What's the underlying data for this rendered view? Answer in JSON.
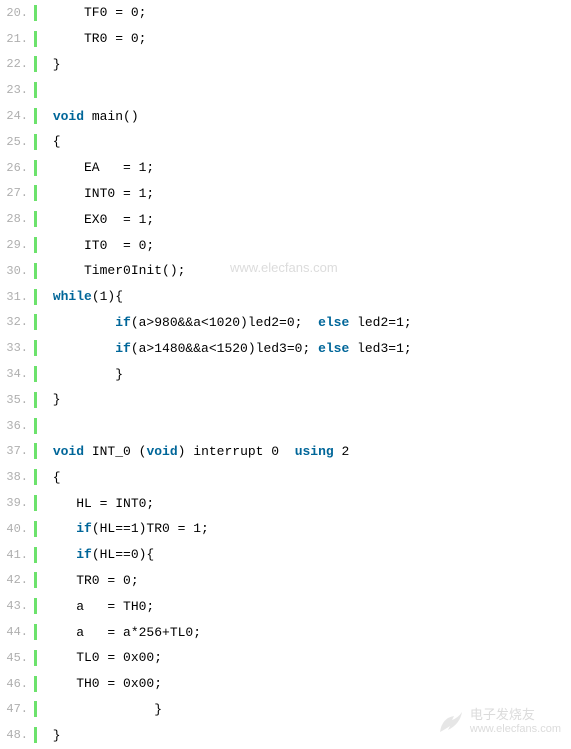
{
  "watermark": "www.elecfans.com",
  "footer": {
    "cn": "电子发烧友",
    "url": "www.elecfans.com"
  },
  "lines": [
    {
      "num": "20.",
      "tokens": [
        {
          "t": "     TF0 = 0;",
          "c": ""
        }
      ]
    },
    {
      "num": "21.",
      "tokens": [
        {
          "t": "     TR0 = 0;",
          "c": ""
        }
      ]
    },
    {
      "num": "22.",
      "tokens": [
        {
          "t": " }",
          "c": ""
        }
      ]
    },
    {
      "num": "23.",
      "tokens": [
        {
          "t": "",
          "c": ""
        }
      ]
    },
    {
      "num": "24.",
      "tokens": [
        {
          "t": " ",
          "c": ""
        },
        {
          "t": "void",
          "c": "keyword"
        },
        {
          "t": " main()",
          "c": ""
        }
      ]
    },
    {
      "num": "25.",
      "tokens": [
        {
          "t": " {",
          "c": ""
        }
      ]
    },
    {
      "num": "26.",
      "tokens": [
        {
          "t": "     EA   = 1;",
          "c": ""
        }
      ]
    },
    {
      "num": "27.",
      "tokens": [
        {
          "t": "     INT0 = 1;",
          "c": ""
        }
      ]
    },
    {
      "num": "28.",
      "tokens": [
        {
          "t": "     EX0  = 1;",
          "c": ""
        }
      ]
    },
    {
      "num": "29.",
      "tokens": [
        {
          "t": "     IT0  = 0;",
          "c": ""
        }
      ]
    },
    {
      "num": "30.",
      "tokens": [
        {
          "t": "     Timer0Init();",
          "c": ""
        }
      ]
    },
    {
      "num": "31.",
      "tokens": [
        {
          "t": " ",
          "c": ""
        },
        {
          "t": "while",
          "c": "keyword"
        },
        {
          "t": "(1){",
          "c": ""
        }
      ]
    },
    {
      "num": "32.",
      "tokens": [
        {
          "t": "         ",
          "c": ""
        },
        {
          "t": "if",
          "c": "keyword"
        },
        {
          "t": "(a>980&&a<1020)led2=0;  ",
          "c": ""
        },
        {
          "t": "else",
          "c": "keyword"
        },
        {
          "t": " led2=1;",
          "c": ""
        }
      ]
    },
    {
      "num": "33.",
      "tokens": [
        {
          "t": "         ",
          "c": ""
        },
        {
          "t": "if",
          "c": "keyword"
        },
        {
          "t": "(a>1480&&a<1520)led3=0; ",
          "c": ""
        },
        {
          "t": "else",
          "c": "keyword"
        },
        {
          "t": " led3=1;",
          "c": ""
        }
      ]
    },
    {
      "num": "34.",
      "tokens": [
        {
          "t": "         }",
          "c": ""
        }
      ]
    },
    {
      "num": "35.",
      "tokens": [
        {
          "t": " }",
          "c": ""
        }
      ]
    },
    {
      "num": "36.",
      "tokens": [
        {
          "t": "",
          "c": ""
        }
      ]
    },
    {
      "num": "37.",
      "tokens": [
        {
          "t": " ",
          "c": ""
        },
        {
          "t": "void",
          "c": "keyword"
        },
        {
          "t": " INT_0 (",
          "c": ""
        },
        {
          "t": "void",
          "c": "keyword"
        },
        {
          "t": ") interrupt 0  ",
          "c": ""
        },
        {
          "t": "using",
          "c": "keyword"
        },
        {
          "t": " 2",
          "c": ""
        }
      ]
    },
    {
      "num": "38.",
      "tokens": [
        {
          "t": " {",
          "c": ""
        }
      ]
    },
    {
      "num": "39.",
      "tokens": [
        {
          "t": "    HL = INT0;",
          "c": ""
        }
      ]
    },
    {
      "num": "40.",
      "tokens": [
        {
          "t": "    ",
          "c": ""
        },
        {
          "t": "if",
          "c": "keyword"
        },
        {
          "t": "(HL==1)TR0 = 1;",
          "c": ""
        }
      ]
    },
    {
      "num": "41.",
      "tokens": [
        {
          "t": "    ",
          "c": ""
        },
        {
          "t": "if",
          "c": "keyword"
        },
        {
          "t": "(HL==0){",
          "c": ""
        }
      ]
    },
    {
      "num": "42.",
      "tokens": [
        {
          "t": "    TR0 = 0;",
          "c": ""
        }
      ]
    },
    {
      "num": "43.",
      "tokens": [
        {
          "t": "    a   = TH0;",
          "c": ""
        }
      ]
    },
    {
      "num": "44.",
      "tokens": [
        {
          "t": "    a   = a*256+TL0;",
          "c": ""
        }
      ]
    },
    {
      "num": "45.",
      "tokens": [
        {
          "t": "    TL0 = 0x00;",
          "c": ""
        }
      ]
    },
    {
      "num": "46.",
      "tokens": [
        {
          "t": "    TH0 = 0x00;",
          "c": ""
        }
      ]
    },
    {
      "num": "47.",
      "tokens": [
        {
          "t": "              }",
          "c": ""
        }
      ]
    },
    {
      "num": "48.",
      "tokens": [
        {
          "t": " }",
          "c": ""
        }
      ]
    }
  ]
}
